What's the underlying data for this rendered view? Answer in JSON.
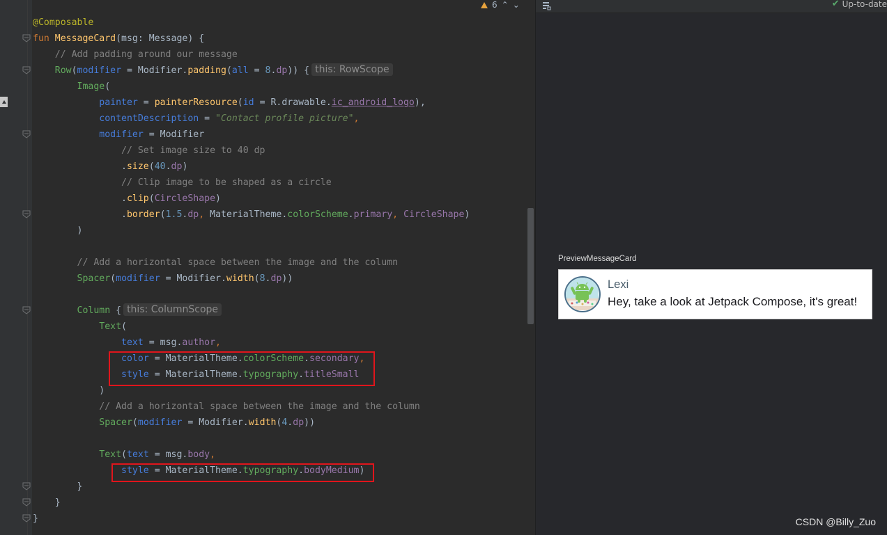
{
  "editor": {
    "warning_count": "6",
    "code": [
      [
        [
          "t-ann",
          "@Composable"
        ]
      ],
      [
        [
          "t-kw",
          "fun "
        ],
        [
          "t-fn",
          "MessageCard"
        ],
        [
          "",
          "(msg: Message) {"
        ]
      ],
      [
        [
          "",
          "    "
        ],
        [
          "t-cm",
          "// Add padding around our message"
        ]
      ],
      [
        [
          "",
          "    "
        ],
        [
          "t-comp",
          "Row"
        ],
        [
          "",
          "("
        ],
        [
          "t-param",
          "modifier"
        ],
        [
          "",
          " = Modifier."
        ],
        [
          "t-ext",
          "padding"
        ],
        [
          "",
          "("
        ],
        [
          "t-param",
          "all"
        ],
        [
          "",
          " = "
        ],
        [
          "t-num",
          "8"
        ],
        [
          "",
          "."
        ],
        [
          "t-prop",
          "dp"
        ],
        [
          "",
          ")) {"
        ],
        [
          "hint",
          "this: RowScope"
        ]
      ],
      [
        [
          "",
          "        "
        ],
        [
          "t-comp",
          "Image"
        ],
        [
          "",
          "("
        ]
      ],
      [
        [
          "",
          "            "
        ],
        [
          "t-param",
          "painter"
        ],
        [
          "",
          " = "
        ],
        [
          "t-fun",
          "painterResource"
        ],
        [
          "",
          "("
        ],
        [
          "t-param",
          "id"
        ],
        [
          "",
          " = R.drawable."
        ],
        [
          "t-link-prop",
          "ic_android_logo"
        ],
        [
          "",
          "),"
        ]
      ],
      [
        [
          "",
          "            "
        ],
        [
          "t-param",
          "contentDescription"
        ],
        [
          "",
          " = "
        ],
        [
          "t-str",
          "\"Contact profile picture\""
        ],
        [
          "t-kw",
          ","
        ]
      ],
      [
        [
          "",
          "            "
        ],
        [
          "t-param",
          "modifier"
        ],
        [
          "",
          " = Modifier"
        ]
      ],
      [
        [
          "",
          "                "
        ],
        [
          "t-cm",
          "// Set image size to 40 dp"
        ]
      ],
      [
        [
          "",
          "                ."
        ],
        [
          "t-ext",
          "size"
        ],
        [
          "",
          "("
        ],
        [
          "t-num",
          "40"
        ],
        [
          "",
          "."
        ],
        [
          "t-prop",
          "dp"
        ],
        [
          "",
          ")"
        ]
      ],
      [
        [
          "",
          "                "
        ],
        [
          "t-cm",
          "// Clip image to be shaped as a circle"
        ]
      ],
      [
        [
          "",
          "                ."
        ],
        [
          "t-ext",
          "clip"
        ],
        [
          "",
          "("
        ],
        [
          "t-prop",
          "CircleShape"
        ],
        [
          "",
          ")"
        ]
      ],
      [
        [
          "",
          "                ."
        ],
        [
          "t-ext",
          "border"
        ],
        [
          "",
          "("
        ],
        [
          "t-num",
          "1.5"
        ],
        [
          "",
          "."
        ],
        [
          "t-prop",
          "dp"
        ],
        [
          "t-kw",
          ", "
        ],
        [
          "",
          "MaterialTheme."
        ],
        [
          "t-comp",
          "colorScheme"
        ],
        [
          "",
          "."
        ],
        [
          "t-prop",
          "primary"
        ],
        [
          "t-kw",
          ", "
        ],
        [
          "t-prop",
          "CircleShape"
        ],
        [
          "",
          ")"
        ]
      ],
      [
        [
          "",
          "        )"
        ]
      ],
      [],
      [
        [
          "",
          "        "
        ],
        [
          "t-cm",
          "// Add a horizontal space between the image and the column"
        ]
      ],
      [
        [
          "",
          "        "
        ],
        [
          "t-comp",
          "Spacer"
        ],
        [
          "",
          "("
        ],
        [
          "t-param",
          "modifier"
        ],
        [
          "",
          " = Modifier."
        ],
        [
          "t-ext",
          "width"
        ],
        [
          "",
          "("
        ],
        [
          "t-num",
          "8"
        ],
        [
          "",
          "."
        ],
        [
          "t-prop",
          "dp"
        ],
        [
          "",
          "))"
        ]
      ],
      [],
      [
        [
          "",
          "        "
        ],
        [
          "t-comp",
          "Column"
        ],
        [
          "",
          " {"
        ],
        [
          "hint",
          "this: ColumnScope"
        ]
      ],
      [
        [
          "",
          "            "
        ],
        [
          "t-comp",
          "Text"
        ],
        [
          "",
          "("
        ]
      ],
      [
        [
          "",
          "                "
        ],
        [
          "t-param",
          "text"
        ],
        [
          "",
          " = msg."
        ],
        [
          "t-prop",
          "author"
        ],
        [
          "t-kw",
          ","
        ]
      ],
      [
        [
          "",
          "                "
        ],
        [
          "t-param",
          "color"
        ],
        [
          "",
          " = MaterialTheme."
        ],
        [
          "t-comp",
          "colorScheme"
        ],
        [
          "",
          "."
        ],
        [
          "t-prop",
          "secondary"
        ],
        [
          "t-kw",
          ","
        ]
      ],
      [
        [
          "",
          "                "
        ],
        [
          "t-param",
          "style"
        ],
        [
          "",
          " = MaterialTheme."
        ],
        [
          "t-comp",
          "typography"
        ],
        [
          "",
          "."
        ],
        [
          "t-prop",
          "titleSmall"
        ]
      ],
      [
        [
          "",
          "            )"
        ]
      ],
      [
        [
          "",
          "            "
        ],
        [
          "t-cm",
          "// Add a horizontal space between the image and the column"
        ]
      ],
      [
        [
          "",
          "            "
        ],
        [
          "t-comp",
          "Spacer"
        ],
        [
          "",
          "("
        ],
        [
          "t-param",
          "modifier"
        ],
        [
          "",
          " = Modifier."
        ],
        [
          "t-ext",
          "width"
        ],
        [
          "",
          "("
        ],
        [
          "t-num",
          "4"
        ],
        [
          "",
          "."
        ],
        [
          "t-prop",
          "dp"
        ],
        [
          "",
          "))"
        ]
      ],
      [],
      [
        [
          "",
          "            "
        ],
        [
          "t-comp",
          "Text"
        ],
        [
          "",
          "("
        ],
        [
          "t-param",
          "text"
        ],
        [
          "",
          " = msg."
        ],
        [
          "t-prop",
          "body"
        ],
        [
          "t-kw",
          ","
        ]
      ],
      [
        [
          "",
          "                "
        ],
        [
          "t-param",
          "style"
        ],
        [
          "",
          " = MaterialTheme."
        ],
        [
          "t-comp",
          "typography"
        ],
        [
          "",
          "."
        ],
        [
          "t-prop",
          "bodyMedium"
        ],
        [
          "",
          ")"
        ]
      ],
      [
        [
          "",
          "        }"
        ]
      ],
      [
        [
          "",
          "    }"
        ]
      ],
      [
        [
          "",
          "}"
        ]
      ]
    ]
  },
  "preview": {
    "status": "Up-to-date",
    "label": "PreviewMessageCard",
    "card": {
      "author": "Lexi",
      "body": "Hey, take a look at Jetpack Compose, it's great!"
    }
  },
  "watermark": "CSDN @Billy_Zuo",
  "colors": {
    "editor_bg": "#2b2b2b",
    "highlight": "#e0151c",
    "preview_bg": "#27282c"
  }
}
